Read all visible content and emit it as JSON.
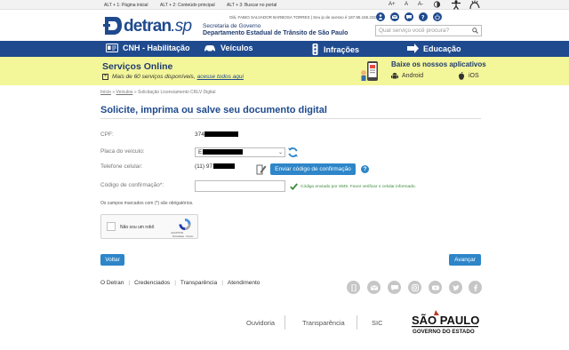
{
  "accessibility": {
    "skip_links": [
      "ALT + 1: Página inicial",
      "ALT + 2: Conteúdo principal",
      "ALT + 3: Buscar no portal"
    ],
    "font_controls": [
      "A+",
      "A",
      "A-"
    ],
    "contrast_icon": "contrast-icon",
    "vlibras_icon": "accessibility-icon"
  },
  "header": {
    "logo_text": "detran",
    "logo_suffix": ".sp",
    "gov_line1": "Secretaria de Governo",
    "gov_line2": "Departamento Estadual de Trânsito de São Paulo",
    "user_line": "Olá, FABIO SALVADOR BARBOSA TORRES | Seu ip de acesso é 187.95.165.232",
    "search_placeholder": "Qual serviço você procura?",
    "user_icons": [
      "user-icon",
      "mail-icon",
      "chat-icon",
      "help-icon",
      "power-icon"
    ]
  },
  "nav": {
    "items": [
      "CNH - Habilitação",
      "Veículos",
      "Infrações",
      "Educação"
    ]
  },
  "banner": {
    "title": "Serviços Online",
    "subtitle": "Mais de 60 serviços disponíveis,",
    "subtitle_link": "acesse todos aqui",
    "apps_title": "Baixe os nossos aplicativos",
    "android": "Android",
    "ios": "iOS"
  },
  "breadcrumb": {
    "home": "Início",
    "vehicles": "Veículos",
    "current": "» Solicitação Licenciamento CRLV Digital"
  },
  "form": {
    "title": "Solicite, imprima ou salve seu documento digital",
    "cpf_label": "CPF:",
    "cpf_value": "374",
    "plate_label": "Placa do veículo:",
    "plate_value": "E",
    "phone_label": "Telefone celular:",
    "phone_value": "(11) 97",
    "send_code_button": "Enviar código de confirmação",
    "code_label": "Código de confirmação*:",
    "code_value": "",
    "code_sent_msg": "Código enviado por SMS. Favor verificar o celular informado.",
    "required_note": "Os campos marcados com (*) são obrigatórios.",
    "recaptcha_label": "Não sou um robô",
    "recaptcha_brand": "reCAPTCHA",
    "recaptcha_links": "Privacidade - Termos",
    "back_button": "Voltar",
    "next_button": "Avançar"
  },
  "footer": {
    "links": [
      "O Detran",
      "Credenciados",
      "Transparência",
      "Atendimento"
    ],
    "social_icons": [
      "mobile-icon",
      "mail-icon",
      "chat-icon",
      "instagram-icon",
      "youtube-icon",
      "twitter-icon",
      "facebook-icon"
    ],
    "bottom_links": [
      "Ouvidoria",
      "Transparência",
      "SIC"
    ],
    "gov_logo_line1": "SÃO PAULO",
    "gov_logo_line2": "GOVERNO DO ESTADO"
  },
  "colors": {
    "brand_blue": "#1f4a8e",
    "accent_blue": "#2e86c9",
    "banner_yellow": "#f4f69a",
    "success_green": "#3a8a3a"
  }
}
